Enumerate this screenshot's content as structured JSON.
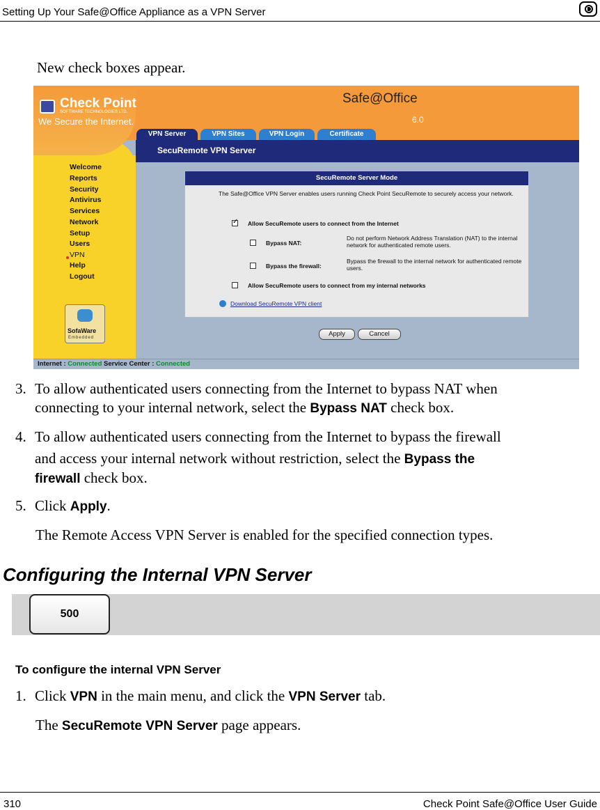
{
  "header": {
    "title": "Setting Up Your Safe@Office Appliance as a VPN Server",
    "icon": "appliance-icon"
  },
  "intro": "New check boxes appear.",
  "screenshot": {
    "brand": "Check Point",
    "brand_sub": "SOFTWARE TECHNOLOGIES LTD.",
    "tagline": "We Secure the Internet.",
    "product": "Safe@Office",
    "version": "6.0",
    "tabs": [
      "VPN Server",
      "VPN Sites",
      "VPN Login",
      "Certificate"
    ],
    "page_title": "SecuRemote VPN Server",
    "nav": [
      "Welcome",
      "Reports",
      "Security",
      "Antivirus",
      "Services",
      "Network",
      "Setup",
      "Users",
      "VPN",
      "Help",
      "Logout"
    ],
    "sofaware": {
      "name": "SofaWare",
      "sub": "Embedded"
    },
    "panel": {
      "title": "SecuRemote Server Mode",
      "description": "The Safe@Office VPN Server enables users running Check Point SecuRemote to securely access your network.",
      "allow_internet": "Allow SecuRemote users to connect from the Internet",
      "bypass_nat": "Bypass NAT:",
      "bypass_nat_desc": "Do not perform Network Address Translation (NAT) to the internal network for authenticated remote users.",
      "bypass_fw": "Bypass the firewall:",
      "bypass_fw_desc": "Bypass the firewall to the internal network for authenticated remote users.",
      "allow_internal": "Allow SecuRemote users to connect from my internal networks",
      "download": "Download SecuRemote VPN client"
    },
    "apply": "Apply",
    "cancel": "Cancel",
    "status": {
      "internet_label": "Internet :",
      "internet_value": "Connected",
      "sc_label": "Service Center :",
      "sc_value": "Connected"
    }
  },
  "steps": {
    "s3_num": "3.",
    "s3_a": "To allow authenticated users connecting from the Internet to bypass NAT when",
    "s3_b1": "connecting to your internal network, select the ",
    "s3_bold": "Bypass NAT",
    "s3_b2": " check box.",
    "s4_num": "4.",
    "s4_a": "To allow authenticated users connecting from the Internet to bypass the firewall",
    "s4_b1": "and access your internal network without restriction, select the ",
    "s4_bold1": "Bypass the",
    "s4_bold2": "firewall",
    "s4_c": " check box.",
    "s5_num": "5.",
    "s5_a": "Click ",
    "s5_bold": "Apply",
    "s5_b": ".",
    "result": "The Remote Access VPN Server is enabled for the specified connection types."
  },
  "section": {
    "heading": "Configuring the Internal VPN Server",
    "model": "500",
    "proc_heading": "To configure the internal VPN Server",
    "s1_num": "1.",
    "s1_a": "Click ",
    "s1_bold1": "VPN",
    "s1_b": " in the main menu, and click the ",
    "s1_bold2": "VPN Server",
    "s1_c": " tab.",
    "r1_a": "The ",
    "r1_bold": "SecuRemote VPN Server",
    "r1_b": " page appears."
  },
  "footer": {
    "page": "310",
    "guide": "Check Point Safe@Office User Guide"
  }
}
